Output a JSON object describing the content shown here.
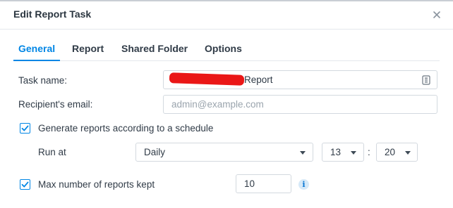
{
  "dialog": {
    "title": "Edit Report Task"
  },
  "tabs": [
    {
      "label": "General",
      "active": true
    },
    {
      "label": "Report",
      "active": false
    },
    {
      "label": "Shared Folder",
      "active": false
    },
    {
      "label": "Options",
      "active": false
    }
  ],
  "form": {
    "task_name": {
      "label": "Task name:",
      "value": "Report"
    },
    "email": {
      "label": "Recipient's email:",
      "value": "",
      "placeholder": "admin@example.com"
    },
    "schedule": {
      "checked": true,
      "label": "Generate reports according to a schedule"
    },
    "run_at": {
      "label": "Run at",
      "frequency": "Daily",
      "hour": "13",
      "minute": "20",
      "separator": ":"
    },
    "max_reports": {
      "checked": true,
      "label": "Max number of reports kept",
      "value": "10"
    }
  },
  "icons": {
    "close": "close-icon",
    "keyboard": "keyboard-icon",
    "info": "info-icon",
    "checkbox": "checkmark-icon"
  },
  "colors": {
    "accent": "#0086e5",
    "redaction": "#ea1717"
  }
}
